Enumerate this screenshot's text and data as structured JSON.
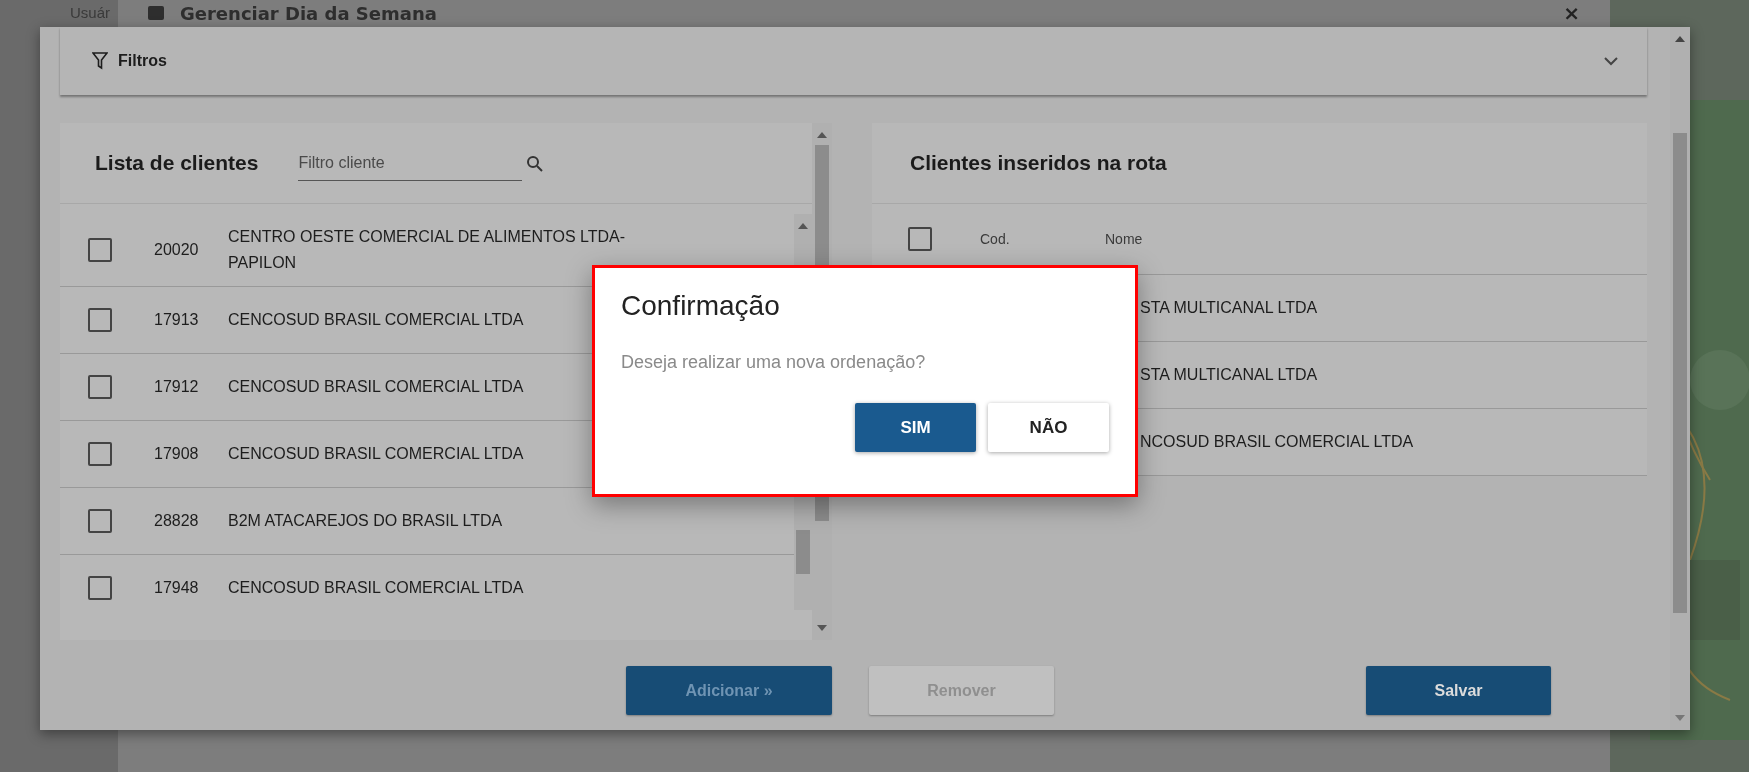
{
  "background": {
    "user_label": "Usuár",
    "dialog_title": "Gerenciar Dia da Semana",
    "close": "×"
  },
  "filters": {
    "label": "Filtros",
    "expanded": false
  },
  "client_list": {
    "title": "Lista de clientes",
    "search": {
      "placeholder": "Filtro cliente"
    },
    "rows": [
      {
        "code": "20020",
        "name": "CENTRO OESTE COMERCIAL DE ALIMENTOS LTDA-PAPILON",
        "checked": false
      },
      {
        "code": "17913",
        "name": "CENCOSUD BRASIL COMERCIAL LTDA",
        "checked": false
      },
      {
        "code": "17912",
        "name": "CENCOSUD BRASIL COMERCIAL LTDA",
        "checked": false
      },
      {
        "code": "17908",
        "name": "CENCOSUD BRASIL COMERCIAL LTDA",
        "checked": false
      },
      {
        "code": "28828",
        "name": "B2M ATACAREJOS DO BRASIL LTDA",
        "checked": false
      },
      {
        "code": "17948",
        "name": "CENCOSUD BRASIL COMERCIAL LTDA",
        "checked": false
      }
    ]
  },
  "route_clients": {
    "title": "Clientes inseridos na rota",
    "header_checked": false,
    "columns": [
      "Cod.",
      "Nome"
    ],
    "rows": [
      {
        "name": "STA MULTICANAL LTDA"
      },
      {
        "name": "STA MULTICANAL LTDA"
      },
      {
        "name": "NCOSUD BRASIL COMERCIAL LTDA"
      }
    ]
  },
  "actions": [
    {
      "label": "Adicionar »",
      "kind": "add",
      "disabled": true
    },
    {
      "label": "Remover",
      "kind": "remove",
      "disabled": true
    },
    {
      "label": "Salvar",
      "kind": "save",
      "disabled": false
    }
  ],
  "confirm": {
    "title": "Confirmação",
    "message": "Deseja realizar uma nova ordenação?",
    "buttons": [
      {
        "label": "SIM",
        "kind": "primary"
      },
      {
        "label": "NÃO",
        "kind": "secondary"
      }
    ]
  }
}
